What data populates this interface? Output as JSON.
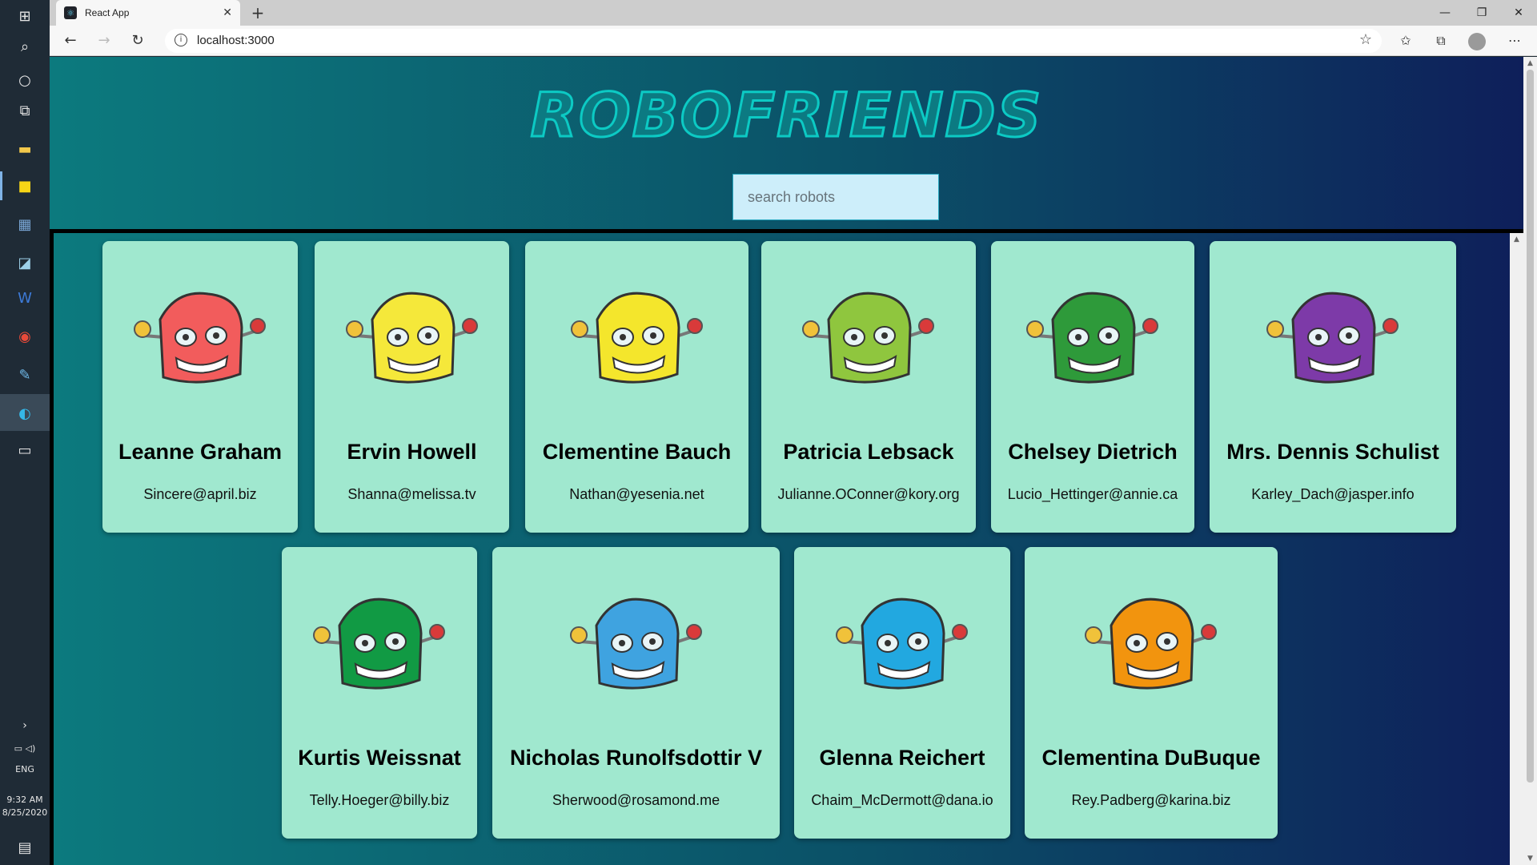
{
  "browser": {
    "tab_title": "React App",
    "url": "localhost:3000"
  },
  "taskbar": {
    "time": "9:32 AM",
    "date": "8/25/2020",
    "language": "ENG"
  },
  "app": {
    "title": "ROBOFRIENDS",
    "search_placeholder": "search robots",
    "robots": [
      {
        "name": "Leanne Graham",
        "email": "Sincere@april.biz",
        "color": "#f25c5c",
        "icon": "robot-red-icon"
      },
      {
        "name": "Ervin Howell",
        "email": "Shanna@melissa.tv",
        "color": "#f5e83a",
        "icon": "robot-yellow-icon"
      },
      {
        "name": "Clementine Bauch",
        "email": "Nathan@yesenia.net",
        "color": "#f4e62c",
        "icon": "robot-yellow-icon"
      },
      {
        "name": "Patricia Lebsack",
        "email": "Julianne.OConner@kory.org",
        "color": "#8fc63e",
        "icon": "robot-lime-icon"
      },
      {
        "name": "Chelsey Dietrich",
        "email": "Lucio_Hettinger@annie.ca",
        "color": "#2e9a3a",
        "icon": "robot-green-icon"
      },
      {
        "name": "Mrs. Dennis Schulist",
        "email": "Karley_Dach@jasper.info",
        "color": "#7d3aa8",
        "icon": "robot-purple-icon"
      },
      {
        "name": "Kurtis Weissnat",
        "email": "Telly.Hoeger@billy.biz",
        "color": "#119a44",
        "icon": "robot-green-icon"
      },
      {
        "name": "Nicholas Runolfsdottir V",
        "email": "Sherwood@rosamond.me",
        "color": "#3fa3e0",
        "icon": "robot-blue-icon"
      },
      {
        "name": "Glenna Reichert",
        "email": "Chaim_McDermott@dana.io",
        "color": "#22a8e0",
        "icon": "robot-blue-icon"
      },
      {
        "name": "Clementina DuBuque",
        "email": "Rey.Padberg@karina.biz",
        "color": "#f2940e",
        "icon": "robot-orange-icon"
      }
    ]
  }
}
